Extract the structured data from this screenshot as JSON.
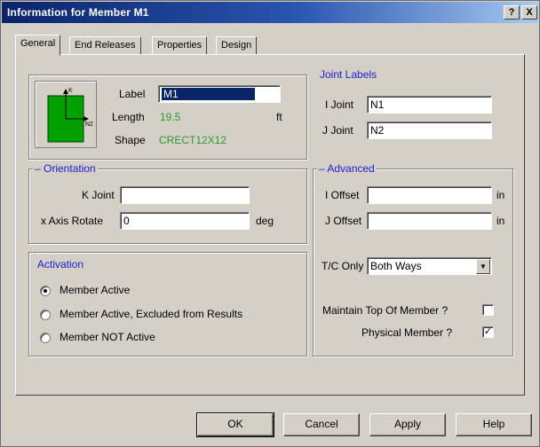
{
  "window": {
    "title": "Information for Member M1",
    "help_btn": "?",
    "close_btn": "X"
  },
  "tabs": [
    "General",
    "End Releases",
    "Properties",
    "Design"
  ],
  "general": {
    "label_caption": "Label",
    "label_value": "M1",
    "length_caption": "Length",
    "length_value": "19.5",
    "length_unit": "ft",
    "shape_caption": "Shape",
    "shape_value": "CRECT12X12",
    "icon_top_label": "K",
    "icon_right_label": "N2"
  },
  "joint_labels": {
    "heading": "Joint Labels",
    "i_caption": "I Joint",
    "i_value": "N1",
    "j_caption": "J Joint",
    "j_value": "N2"
  },
  "orientation": {
    "heading": "Orientation",
    "k_caption": "K Joint",
    "k_value": "",
    "rotate_caption": "x Axis Rotate",
    "rotate_value": "0",
    "rotate_unit": "deg"
  },
  "advanced": {
    "heading": "Advanced",
    "i_offset_caption": "I Offset",
    "i_offset_value": "",
    "i_offset_unit": "in",
    "j_offset_caption": "J Offset",
    "j_offset_value": "",
    "j_offset_unit": "in",
    "tc_caption": "T/C Only",
    "tc_value": "Both Ways",
    "maintain_caption": "Maintain Top Of Member ?",
    "maintain_checked": false,
    "physical_caption": "Physical Member ?",
    "physical_checked": true,
    "check_mark": "✓"
  },
  "activation": {
    "heading": "Activation",
    "options": [
      "Member Active",
      "Member Active, Excluded from Results",
      "Member NOT Active"
    ],
    "selected_index": 0
  },
  "buttons": {
    "ok": "OK",
    "cancel": "Cancel",
    "apply": "Apply",
    "help": "Help"
  },
  "colors": {
    "member_fill": "#00a000",
    "legend_blue": "#2020d0",
    "value_green": "#2a9a2a"
  }
}
